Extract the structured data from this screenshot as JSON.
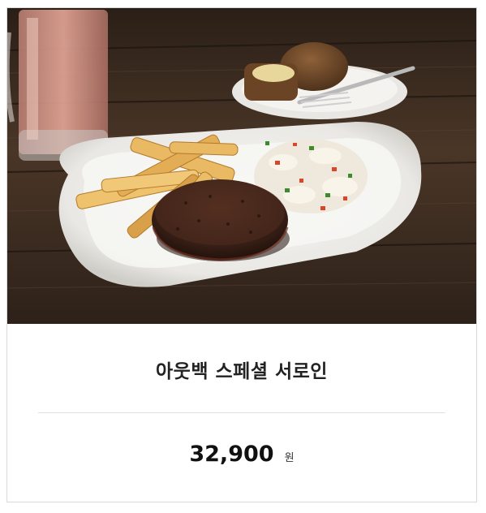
{
  "product": {
    "image_alt": "steak plate",
    "name": "아웃백 스페셜 서로인",
    "price": "32,900",
    "price_unit": "원"
  },
  "colors": {
    "title_text": "#222222",
    "divider": "#e2e2e2",
    "card_border": "#d9d9d9"
  }
}
